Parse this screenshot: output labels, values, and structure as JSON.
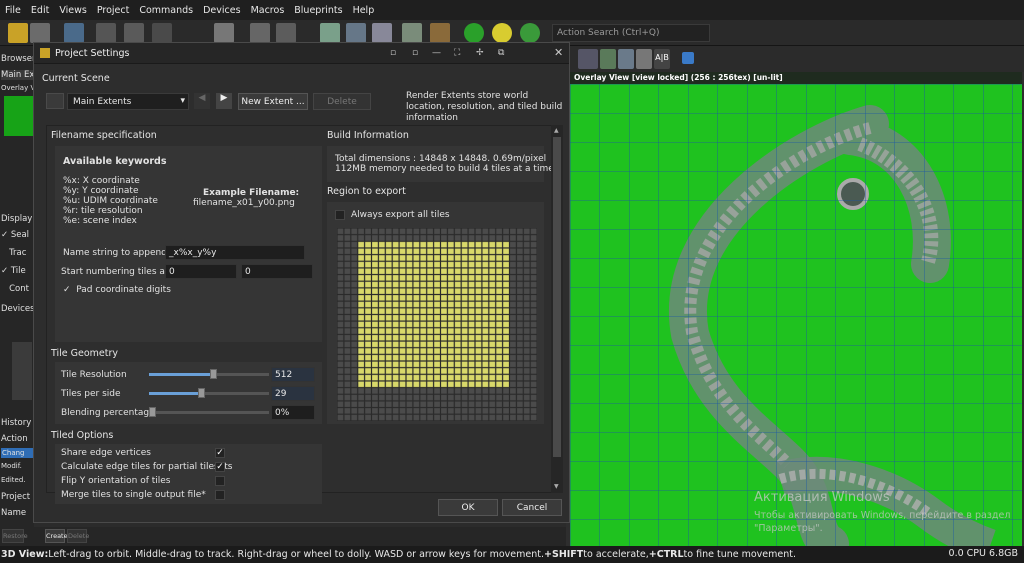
{
  "menu": [
    "File",
    "Edit",
    "Views",
    "Project",
    "Commands",
    "Devices",
    "Macros",
    "Blueprints",
    "Help"
  ],
  "search": {
    "placeholder": "Action Search (Ctrl+Q)"
  },
  "left": {
    "browser": "Browser",
    "main_extents_tab": "Main Exte",
    "overlay": "Overlay V",
    "display": "Display",
    "seal": "Seal",
    "trac": "Trac",
    "tile": "Tile",
    "cont": "Cont",
    "devices": "Devices",
    "history": "History",
    "action": "Action",
    "chang": "Chang",
    "modif": "Modif.",
    "edited": "Edited.",
    "project": "Project",
    "name": "Name",
    "restore": "Restore",
    "create": "Create",
    "delete": "Delete"
  },
  "dialog": {
    "title": "Project Settings",
    "current_scene": "Current Scene",
    "scene_value": "Main Extents",
    "new_extent": "New Extent ...",
    "delete": "Delete",
    "info": "Render Extents store world location, resolution, and tiled build information",
    "filename_spec": "Filename specification",
    "available_keywords": "Available keywords",
    "keywords": [
      "%x: X coordinate",
      "%y: Y coordinate",
      "%u: UDIM coordinate",
      "%r: tile resolution",
      "%e: scene index"
    ],
    "example_title": "Example Filename:",
    "example_value": "filename_x01_y00.png",
    "name_string_label": "Name string to append:",
    "name_string_value": "_x%x_y%y",
    "start_num_label": "Start numbering tiles at:",
    "start_x": "0",
    "start_y": "0",
    "pad_label": "Pad coordinate digits",
    "build_info": "Build Information",
    "build_line1": "Total dimensions : 14848 x 14848. 0.69m/pixel",
    "build_line2": "112MB memory needed to build 4 tiles at a time",
    "region": "Region to export",
    "always_export": "Always export all tiles",
    "tile_geometry": "Tile Geometry",
    "tile_res_label": "Tile Resolution",
    "tile_res_value": "512",
    "tiles_per_side_label": "Tiles per side",
    "tiles_per_side_value": "29",
    "blend_label": "Blending percentage",
    "blend_value": "0%",
    "tiled_options": "Tiled Options",
    "opt_share": "Share edge vertices",
    "opt_calc": "Calculate edge tiles for partial tilesets",
    "opt_flip": "Flip Y orientation of tiles",
    "opt_merge": "Merge tiles to single output file*",
    "ok": "OK",
    "cancel": "Cancel"
  },
  "viewport": {
    "bar": "Overlay View [view locked] (256 : 256tex)  [un-lit]"
  },
  "watermark": {
    "title": "Активация Windows",
    "sub": "Чтобы активировать Windows, перейдите в раздел \"Параметры\"."
  },
  "status": {
    "left_a": "3D View:",
    "left_b": " Left-drag to orbit. Middle-drag to track. Right-drag or wheel to dolly. WASD or arrow keys for movement. ",
    "shift": "+SHIFT",
    "left_c": " to accelerate, ",
    "ctrl": "+CTRL",
    "left_d": " to fine tune movement.",
    "right": "0.0 CPU 6.8GB"
  },
  "colors": {
    "terrain": "#1fc21f",
    "tiles_selected": "#d8d86a",
    "accent": "#6aa0d8"
  }
}
